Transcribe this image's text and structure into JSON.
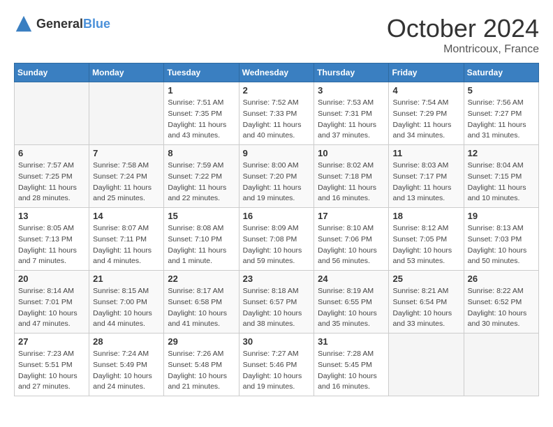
{
  "header": {
    "logo_general": "General",
    "logo_blue": "Blue",
    "month": "October 2024",
    "location": "Montricoux, France"
  },
  "days_of_week": [
    "Sunday",
    "Monday",
    "Tuesday",
    "Wednesday",
    "Thursday",
    "Friday",
    "Saturday"
  ],
  "weeks": [
    [
      {
        "day": "",
        "info": ""
      },
      {
        "day": "",
        "info": ""
      },
      {
        "day": "1",
        "info": "Sunrise: 7:51 AM\nSunset: 7:35 PM\nDaylight: 11 hours and 43 minutes."
      },
      {
        "day": "2",
        "info": "Sunrise: 7:52 AM\nSunset: 7:33 PM\nDaylight: 11 hours and 40 minutes."
      },
      {
        "day": "3",
        "info": "Sunrise: 7:53 AM\nSunset: 7:31 PM\nDaylight: 11 hours and 37 minutes."
      },
      {
        "day": "4",
        "info": "Sunrise: 7:54 AM\nSunset: 7:29 PM\nDaylight: 11 hours and 34 minutes."
      },
      {
        "day": "5",
        "info": "Sunrise: 7:56 AM\nSunset: 7:27 PM\nDaylight: 11 hours and 31 minutes."
      }
    ],
    [
      {
        "day": "6",
        "info": "Sunrise: 7:57 AM\nSunset: 7:25 PM\nDaylight: 11 hours and 28 minutes."
      },
      {
        "day": "7",
        "info": "Sunrise: 7:58 AM\nSunset: 7:24 PM\nDaylight: 11 hours and 25 minutes."
      },
      {
        "day": "8",
        "info": "Sunrise: 7:59 AM\nSunset: 7:22 PM\nDaylight: 11 hours and 22 minutes."
      },
      {
        "day": "9",
        "info": "Sunrise: 8:00 AM\nSunset: 7:20 PM\nDaylight: 11 hours and 19 minutes."
      },
      {
        "day": "10",
        "info": "Sunrise: 8:02 AM\nSunset: 7:18 PM\nDaylight: 11 hours and 16 minutes."
      },
      {
        "day": "11",
        "info": "Sunrise: 8:03 AM\nSunset: 7:17 PM\nDaylight: 11 hours and 13 minutes."
      },
      {
        "day": "12",
        "info": "Sunrise: 8:04 AM\nSunset: 7:15 PM\nDaylight: 11 hours and 10 minutes."
      }
    ],
    [
      {
        "day": "13",
        "info": "Sunrise: 8:05 AM\nSunset: 7:13 PM\nDaylight: 11 hours and 7 minutes."
      },
      {
        "day": "14",
        "info": "Sunrise: 8:07 AM\nSunset: 7:11 PM\nDaylight: 11 hours and 4 minutes."
      },
      {
        "day": "15",
        "info": "Sunrise: 8:08 AM\nSunset: 7:10 PM\nDaylight: 11 hours and 1 minute."
      },
      {
        "day": "16",
        "info": "Sunrise: 8:09 AM\nSunset: 7:08 PM\nDaylight: 10 hours and 59 minutes."
      },
      {
        "day": "17",
        "info": "Sunrise: 8:10 AM\nSunset: 7:06 PM\nDaylight: 10 hours and 56 minutes."
      },
      {
        "day": "18",
        "info": "Sunrise: 8:12 AM\nSunset: 7:05 PM\nDaylight: 10 hours and 53 minutes."
      },
      {
        "day": "19",
        "info": "Sunrise: 8:13 AM\nSunset: 7:03 PM\nDaylight: 10 hours and 50 minutes."
      }
    ],
    [
      {
        "day": "20",
        "info": "Sunrise: 8:14 AM\nSunset: 7:01 PM\nDaylight: 10 hours and 47 minutes."
      },
      {
        "day": "21",
        "info": "Sunrise: 8:15 AM\nSunset: 7:00 PM\nDaylight: 10 hours and 44 minutes."
      },
      {
        "day": "22",
        "info": "Sunrise: 8:17 AM\nSunset: 6:58 PM\nDaylight: 10 hours and 41 minutes."
      },
      {
        "day": "23",
        "info": "Sunrise: 8:18 AM\nSunset: 6:57 PM\nDaylight: 10 hours and 38 minutes."
      },
      {
        "day": "24",
        "info": "Sunrise: 8:19 AM\nSunset: 6:55 PM\nDaylight: 10 hours and 35 minutes."
      },
      {
        "day": "25",
        "info": "Sunrise: 8:21 AM\nSunset: 6:54 PM\nDaylight: 10 hours and 33 minutes."
      },
      {
        "day": "26",
        "info": "Sunrise: 8:22 AM\nSunset: 6:52 PM\nDaylight: 10 hours and 30 minutes."
      }
    ],
    [
      {
        "day": "27",
        "info": "Sunrise: 7:23 AM\nSunset: 5:51 PM\nDaylight: 10 hours and 27 minutes."
      },
      {
        "day": "28",
        "info": "Sunrise: 7:24 AM\nSunset: 5:49 PM\nDaylight: 10 hours and 24 minutes."
      },
      {
        "day": "29",
        "info": "Sunrise: 7:26 AM\nSunset: 5:48 PM\nDaylight: 10 hours and 21 minutes."
      },
      {
        "day": "30",
        "info": "Sunrise: 7:27 AM\nSunset: 5:46 PM\nDaylight: 10 hours and 19 minutes."
      },
      {
        "day": "31",
        "info": "Sunrise: 7:28 AM\nSunset: 5:45 PM\nDaylight: 10 hours and 16 minutes."
      },
      {
        "day": "",
        "info": ""
      },
      {
        "day": "",
        "info": ""
      }
    ]
  ]
}
